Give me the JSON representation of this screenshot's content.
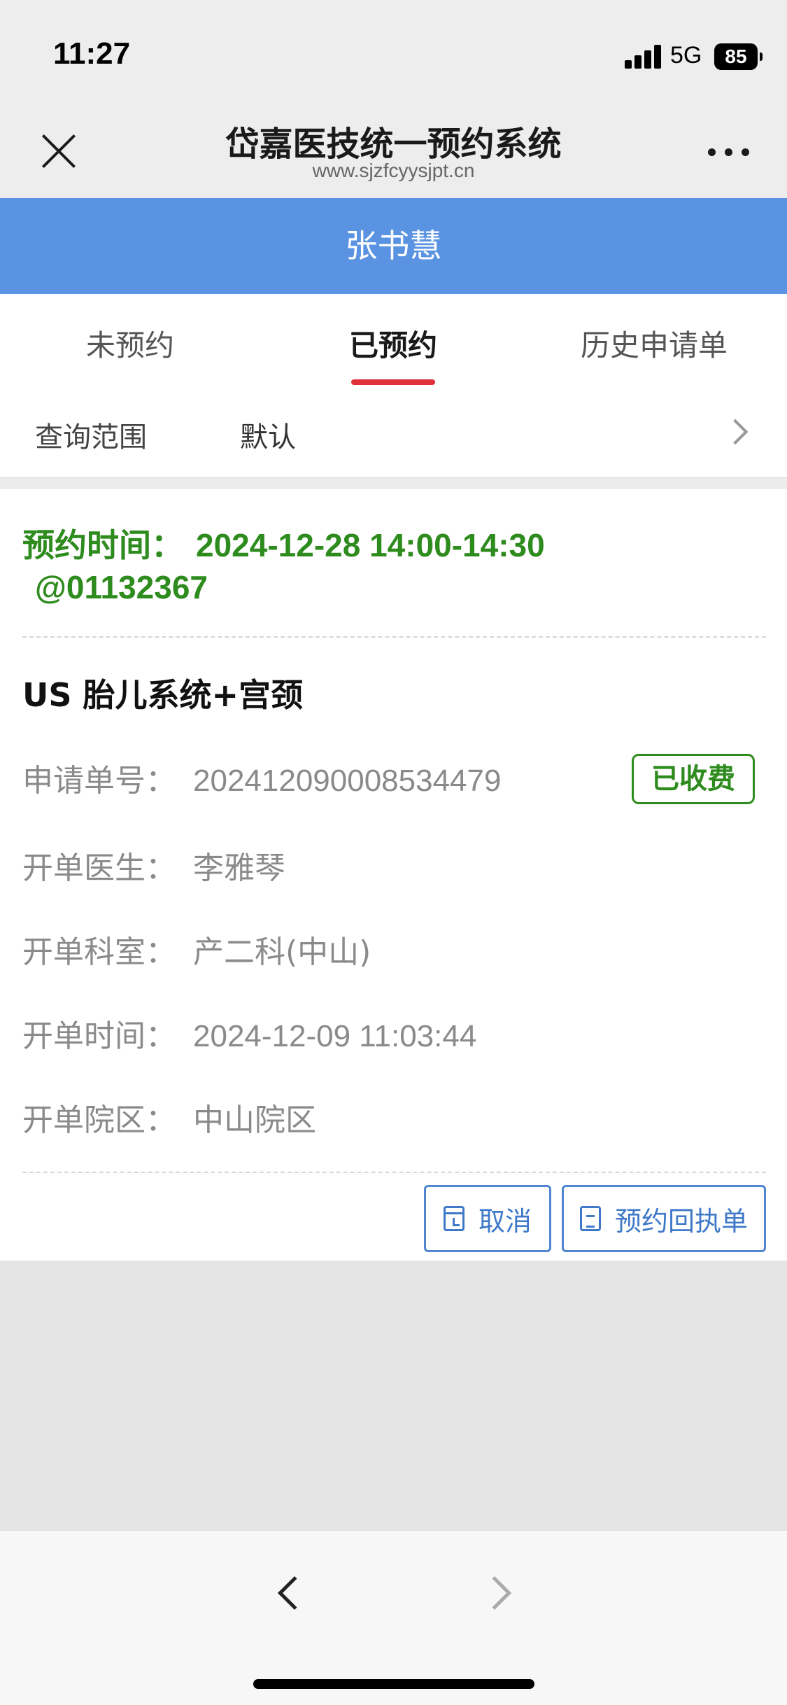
{
  "status_bar": {
    "time": "11:27",
    "network": "5G",
    "battery": "85"
  },
  "nav": {
    "title": "岱嘉医技统一预约系统",
    "url": "www.sjzfcyysjpt.cn"
  },
  "header": {
    "user_name": "张书慧"
  },
  "tabs": [
    {
      "label": "未预约",
      "active": false
    },
    {
      "label": "已预约",
      "active": true
    },
    {
      "label": "历史申请单",
      "active": false
    }
  ],
  "filter": {
    "label": "查询范围",
    "value": "默认"
  },
  "card": {
    "appointment_label": "预约时间：",
    "appointment_value": "2024-12-28  14:00-14:30",
    "appointment_code": "@01132367",
    "exam_name": "US 胎儿系统+宫颈",
    "paid_badge": "已收费",
    "fields": [
      {
        "key": "申请单号：",
        "value": "20241209000853447​9"
      },
      {
        "key": "开单医生：",
        "value": "李雅琴"
      },
      {
        "key": "开单科室：",
        "value": "产二科(中山)"
      },
      {
        "key": "开单时间：",
        "value": "2024-12-09 11:03:44"
      },
      {
        "key": "开单院区：",
        "value": "中山院区"
      }
    ],
    "cancel_label": "取消",
    "receipt_label": "预约回执单"
  },
  "colors": {
    "accent_blue": "#5a93e2",
    "success_green": "#2e8b1e",
    "tab_indicator": "#e0303a"
  },
  "icons": [
    "close-icon",
    "more-icon",
    "chevron-right-icon",
    "calendar-icon",
    "document-icon",
    "back-icon",
    "forward-icon"
  ]
}
